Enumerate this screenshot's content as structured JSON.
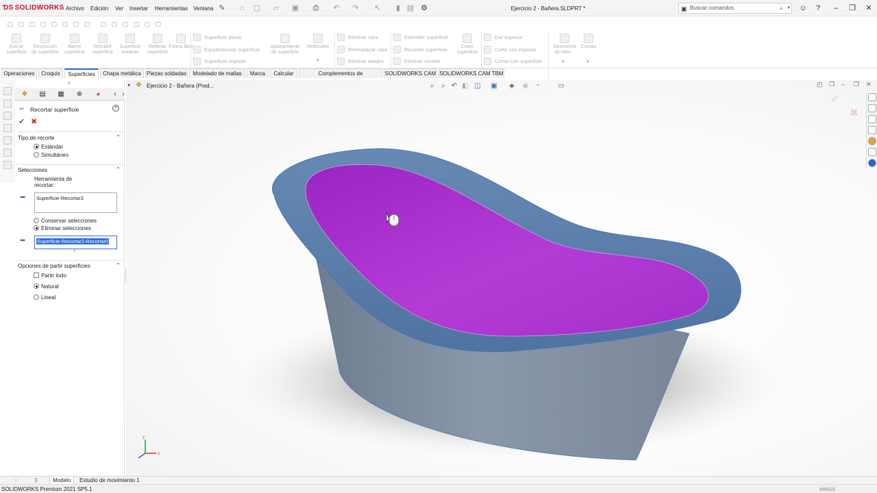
{
  "app": {
    "logo_text": "SOLIDWORKS",
    "document_title": "Ejercicio 2 - Bañera.SLDPRT *"
  },
  "menu": {
    "items": [
      "Archivo",
      "Edición",
      "Ver",
      "Insertar",
      "Herramientas",
      "Ventana"
    ]
  },
  "search": {
    "placeholder": "Buscar comandos"
  },
  "commands": {
    "big": [
      {
        "label": "Extruir superficie",
        "icon": "extrude-surface-icon"
      },
      {
        "label": "Revolución de superficie",
        "icon": "revolve-surface-icon"
      },
      {
        "label": "Barrer superficie",
        "icon": "sweep-surface-icon"
      },
      {
        "label": "Recubrir superficie",
        "icon": "loft-surface-icon"
      },
      {
        "label": "Superficie limitante",
        "icon": "boundary-surface-icon"
      },
      {
        "label": "Rellenar superficie",
        "icon": "fill-surface-icon"
      },
      {
        "label": "Forma libre",
        "icon": "freeform-icon"
      }
    ],
    "col1": [
      "Superficie plana",
      "Equidistanciar superficie",
      "Superficie reglada"
    ],
    "big2": [
      {
        "label": "Aplanamiento de superficie",
        "icon": "flatten-surface-icon"
      },
      {
        "label": "Redondeo",
        "icon": "fillet-icon"
      }
    ],
    "col2": [
      "Eliminar cara",
      "Reemplazar cara",
      "Eliminar taladro"
    ],
    "col3": [
      "Extender superficie",
      "Recortar superficie",
      "Eliminar recorte"
    ],
    "big3": [
      {
        "label": "Coser superficie",
        "icon": "knit-surface-icon"
      }
    ],
    "col4": [
      "Dar espesor",
      "Corte con espesor",
      "Cortar con superficie"
    ],
    "big4": [
      {
        "label": "Geometría de refer...",
        "icon": "reference-geometry-icon"
      },
      {
        "label": "Curvas",
        "icon": "curves-icon"
      }
    ]
  },
  "tabs": [
    "Operaciones",
    "Croquis",
    "Superficies",
    "Chapa metálica",
    "Piezas soldadas",
    "Modelado de mallas",
    "Marca",
    "Calcular",
    "Complementos de SOLIDWORKS",
    "SOLIDWORKS CAM",
    "SOLIDWORKS CAM TBM"
  ],
  "active_tab": "Superficies",
  "property_manager": {
    "title": "Recortar superficie",
    "trim_type": {
      "header": "Tipo de recorte",
      "options": [
        "Estándar",
        "Simultáneo"
      ],
      "selected": "Estándar"
    },
    "selections": {
      "header": "Selecciones",
      "tool_label": "Herramienta de recortar:",
      "tool_value": "Superficie-Recortar3",
      "options": [
        "Conservar selecciones",
        "Eliminar selecciones"
      ],
      "selected": "Eliminar selecciones",
      "pieces_value": "Superficie-Recortar2-Recortar0"
    },
    "split_options": {
      "header": "Opciones de partir superficies",
      "split_all": "Partir todo",
      "options": [
        "Natural",
        "Lineal"
      ],
      "selected": "Natural"
    }
  },
  "graphics": {
    "tree_flyout": "Ejercicio 2 - Bañera  (Pred...",
    "colors": {
      "tub_inner": "#a42bc9",
      "tub_rim": "#5a7fae",
      "tub_body": "#7a8aa0"
    }
  },
  "bottom_tabs": [
    "Modelo",
    "Estudio de movimiento 1"
  ],
  "bottom_nav_number": "3",
  "status": {
    "text": "SOLIDWORKS Premium 2021 SP5.1",
    "units": "MMGS"
  }
}
